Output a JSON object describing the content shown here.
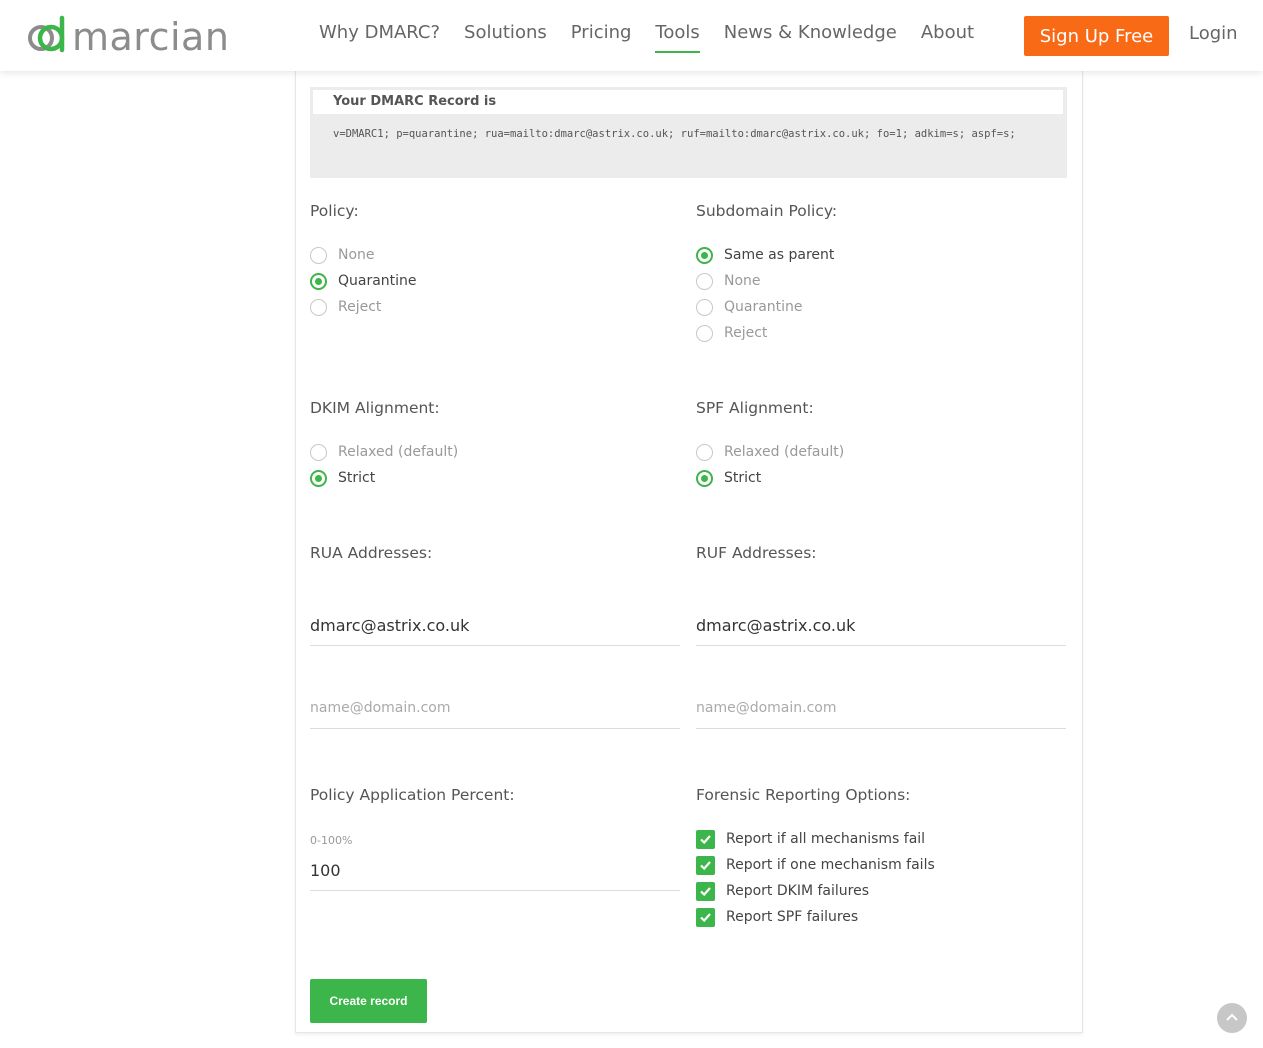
{
  "brand": {
    "logo_text": "dmarcian"
  },
  "nav": {
    "items": [
      {
        "label": "Why DMARC?"
      },
      {
        "label": "Solutions"
      },
      {
        "label": "Pricing"
      },
      {
        "label": "Tools",
        "active": true
      },
      {
        "label": "News & Knowledge"
      },
      {
        "label": "About"
      }
    ],
    "signup_label": "Sign Up Free",
    "login_label": "Login"
  },
  "record": {
    "title": "Your DMARC Record is",
    "value": "v=DMARC1; p=quarantine; rua=mailto:dmarc@astrix.co.uk; ruf=mailto:dmarc@astrix.co.uk; fo=1; adkim=s; aspf=s;"
  },
  "policy": {
    "title": "Policy:",
    "options": [
      "None",
      "Quarantine",
      "Reject"
    ],
    "selected": "Quarantine"
  },
  "subdomain_policy": {
    "title": "Subdomain Policy:",
    "options": [
      "Same as parent",
      "None",
      "Quarantine",
      "Reject"
    ],
    "selected": "Same as parent"
  },
  "dkim": {
    "title": "DKIM Alignment:",
    "options": [
      "Relaxed (default)",
      "Strict"
    ],
    "selected": "Strict"
  },
  "spf": {
    "title": "SPF Alignment:",
    "options": [
      "Relaxed (default)",
      "Strict"
    ],
    "selected": "Strict"
  },
  "rua": {
    "title": "RUA Addresses:",
    "value": "dmarc@astrix.co.uk",
    "placeholder": "name@domain.com"
  },
  "ruf": {
    "title": "RUF Addresses:",
    "value": "dmarc@astrix.co.uk",
    "placeholder": "name@domain.com"
  },
  "percent": {
    "title": "Policy Application Percent:",
    "hint": "0-100%",
    "value": "100"
  },
  "forensic": {
    "title": "Forensic Reporting Options:",
    "options": [
      {
        "label": "Report if all mechanisms fail",
        "checked": true
      },
      {
        "label": "Report if one mechanism fails",
        "checked": true
      },
      {
        "label": "Report DKIM failures",
        "checked": true
      },
      {
        "label": "Report SPF failures",
        "checked": true
      }
    ]
  },
  "actions": {
    "create_label": "Create record"
  },
  "colors": {
    "accent": "#3cb54a",
    "signup": "#f96a16",
    "logo_gray": "#8c8c8c"
  }
}
